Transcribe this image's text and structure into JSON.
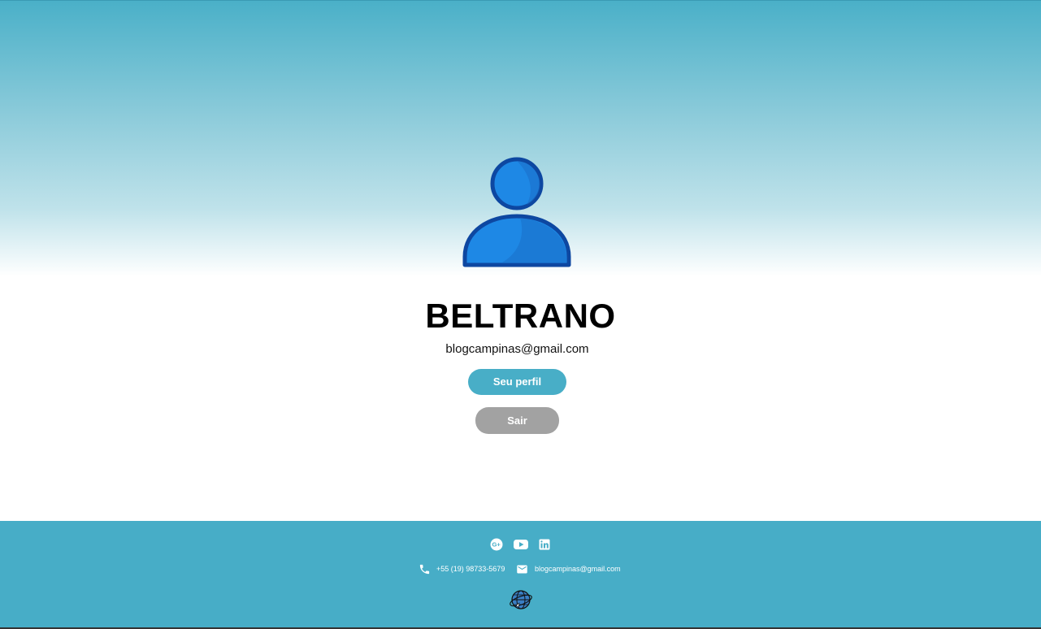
{
  "profile": {
    "name": "BELTRANO",
    "email": "blogcampinas@gmail.com",
    "avatar_icon": "user-avatar-icon"
  },
  "actions": {
    "profile_label": "Seu perfil",
    "logout_label": "Sair"
  },
  "footer": {
    "social": [
      {
        "icon": "google-plus-icon"
      },
      {
        "icon": "youtube-icon"
      },
      {
        "icon": "linkedin-icon"
      }
    ],
    "phone": "+55 (19) 98733-5679",
    "email": "blogcampinas@gmail.com",
    "logo_icon": "globe-logo-icon"
  },
  "colors": {
    "accent": "#48aec7",
    "logout": "#a2a2a2",
    "footer": "#47adc7",
    "avatar_fill": "#1e88e5",
    "avatar_stroke": "#0d47a1"
  }
}
